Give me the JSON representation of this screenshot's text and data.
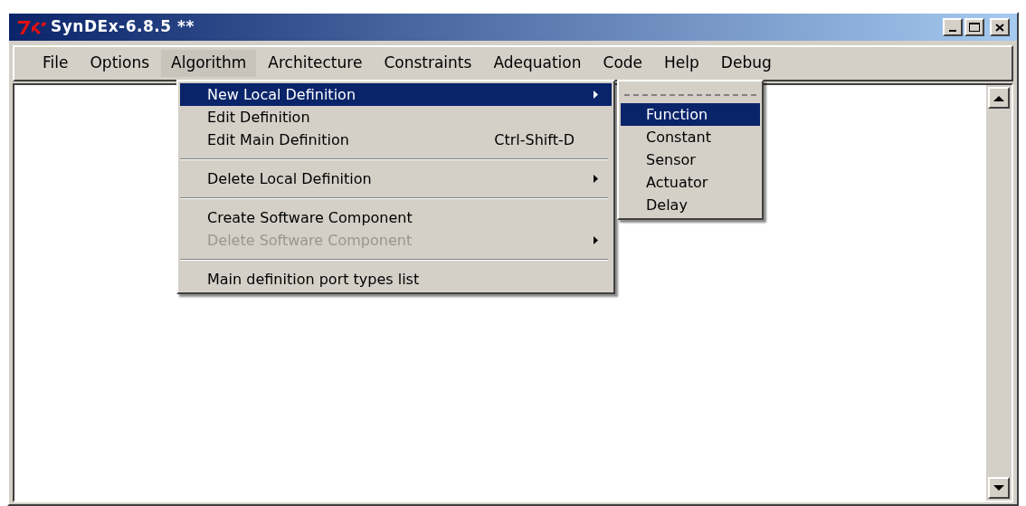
{
  "window": {
    "title": "SynDEx-6.8.5 **"
  },
  "menu_bar": [
    {
      "label": "File",
      "selected": false
    },
    {
      "label": "Options",
      "selected": false
    },
    {
      "label": "Algorithm",
      "selected": true
    },
    {
      "label": "Architecture",
      "selected": false
    },
    {
      "label": "Constraints",
      "selected": false
    },
    {
      "label": "Adequation",
      "selected": false
    },
    {
      "label": "Code",
      "selected": false
    },
    {
      "label": "Help",
      "selected": false
    },
    {
      "label": "Debug",
      "selected": false
    }
  ],
  "menu": [
    {
      "kind": "item",
      "label": "New Local Definition",
      "submenu": true,
      "selected": true,
      "disabled": false
    },
    {
      "kind": "item",
      "label": "Edit Definition",
      "submenu": false,
      "selected": false,
      "disabled": false
    },
    {
      "kind": "item",
      "label": "Edit Main Definition",
      "shortcut": "Ctrl-Shift-D",
      "submenu": false,
      "selected": false,
      "disabled": false
    },
    {
      "kind": "separator"
    },
    {
      "kind": "item",
      "label": "Delete Local Definition",
      "submenu": true,
      "selected": false,
      "disabled": false
    },
    {
      "kind": "separator"
    },
    {
      "kind": "item",
      "label": "Create Software Component",
      "submenu": false,
      "selected": false,
      "disabled": false
    },
    {
      "kind": "item",
      "label": "Delete Software Component",
      "submenu": true,
      "selected": false,
      "disabled": true
    },
    {
      "kind": "separator"
    },
    {
      "kind": "item",
      "label": "Main definition port types list",
      "submenu": false,
      "selected": false,
      "disabled": false
    }
  ],
  "submenu": [
    {
      "kind": "tearoff"
    },
    {
      "kind": "item",
      "label": "Function",
      "selected": true
    },
    {
      "kind": "item",
      "label": "Constant",
      "selected": false
    },
    {
      "kind": "item",
      "label": "Sensor",
      "selected": false
    },
    {
      "kind": "item",
      "label": "Actuator",
      "selected": false
    },
    {
      "kind": "item",
      "label": "Delay",
      "selected": false
    }
  ]
}
